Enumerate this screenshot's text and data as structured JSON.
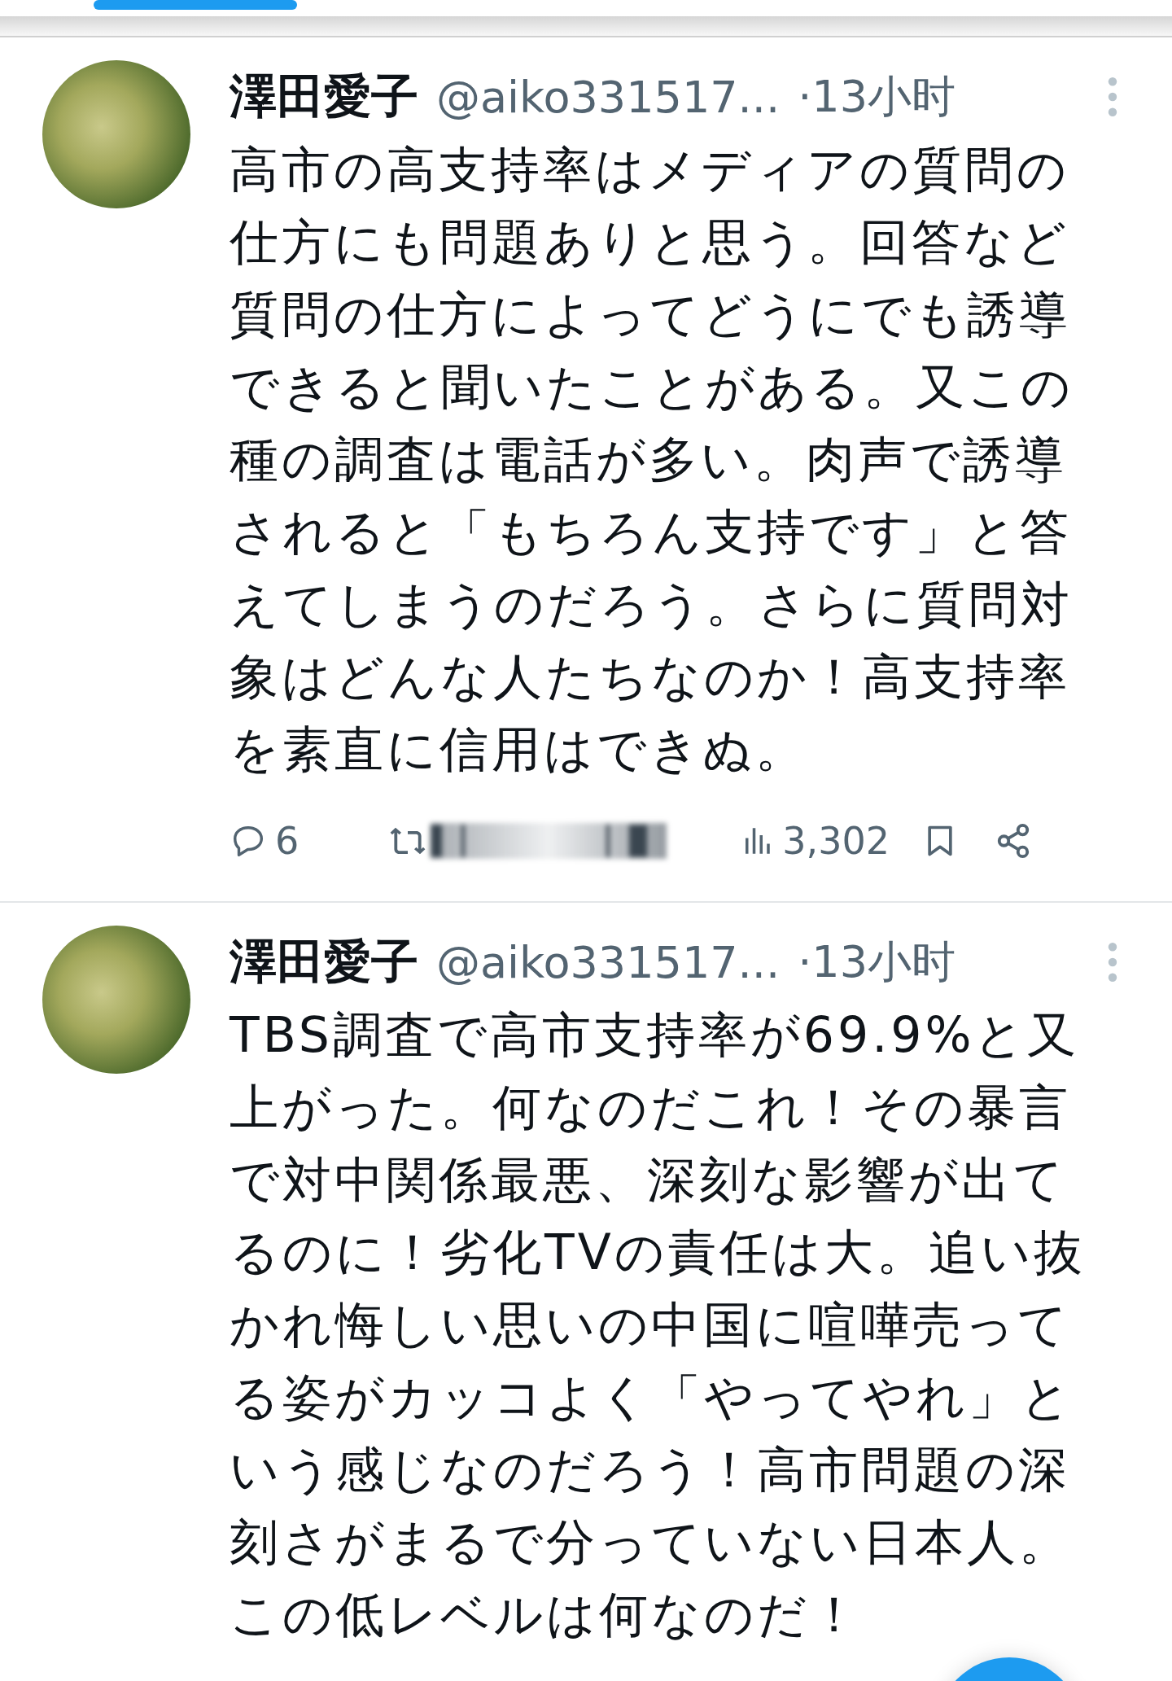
{
  "tweets": [
    {
      "author": "澤田愛子",
      "handle": "@aiko331517...",
      "time": "·13小时",
      "text": "高市の高支持率はメディアの質問の仕方にも問題ありと思う。回答など質問の仕方によってどうにでも誘導できると聞いたことがある。又この種の調査は電話が多い。肉声で誘導されると「もちろん支持です」と答えてしまうのだろう。さらに質問対象はどんな人たちなのか！高支持率を素直に信用はできぬ。",
      "actions": {
        "replies": "6",
        "views": "3,302"
      }
    },
    {
      "author": "澤田愛子",
      "handle": "@aiko331517...",
      "time": "·13小时",
      "text": "TBS調査で高市支持率が69.9%と又上がった。何なのだこれ！その暴言で対中関係最悪、深刻な影響が出てるのに！劣化TVの責任は大。追い抜かれ悔しい思いの中国に喧嘩売ってる姿がカッコよく「やってやれ」という感じなのだろう！高市問題の深刻さがまるで分っていない日本人。この低レベルは何なのだ！"
    }
  ]
}
